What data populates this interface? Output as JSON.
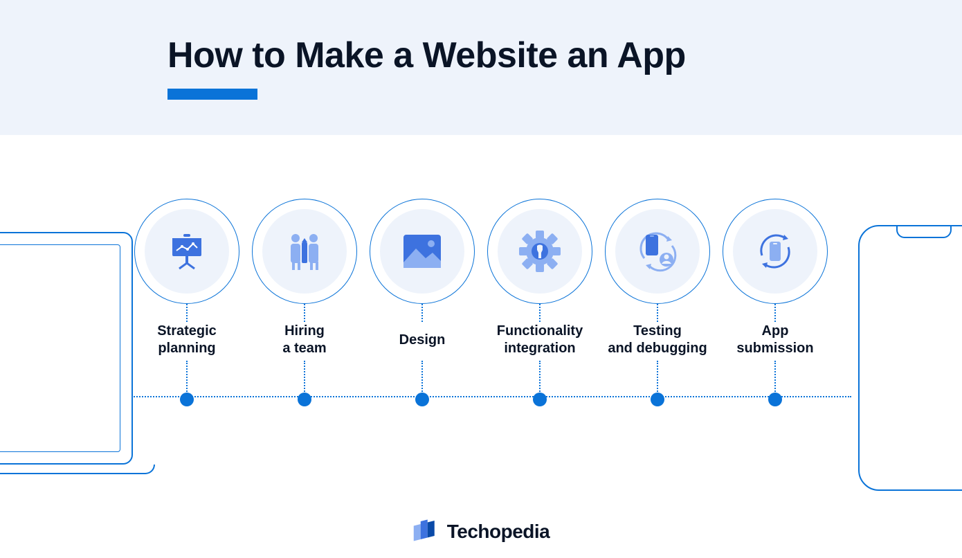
{
  "header": {
    "title": "How to Make a Website an App"
  },
  "steps": [
    {
      "label": "Strategic\nplanning",
      "icon": "presentation-chart-icon"
    },
    {
      "label": "Hiring\na team",
      "icon": "team-icon"
    },
    {
      "label": "Design",
      "icon": "image-icon"
    },
    {
      "label": "Functionality\nintegration",
      "icon": "gear-wrench-icon"
    },
    {
      "label": "Testing\nand debugging",
      "icon": "device-user-cycle-icon"
    },
    {
      "label": "App\nsubmission",
      "icon": "device-refresh-icon"
    }
  ],
  "brand": {
    "name": "Techopedia"
  },
  "colors": {
    "accent": "#0a73d8",
    "icon_light": "#8caff2",
    "icon_dark": "#3d72df",
    "header_bg": "#eef3fb"
  }
}
